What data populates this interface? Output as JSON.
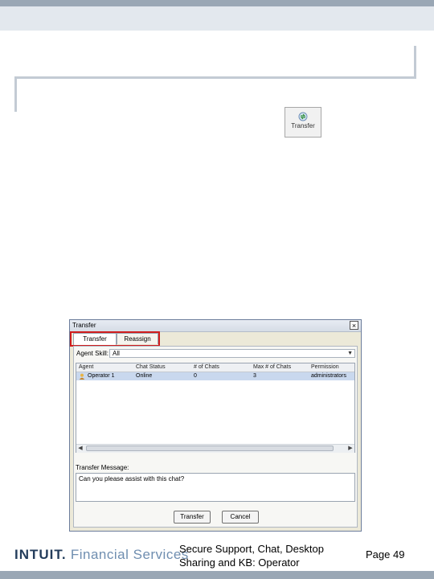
{
  "toolbar": {
    "transfer_label": "Transfer"
  },
  "dialog": {
    "title": "Transfer",
    "close_glyph": "×",
    "tabs": [
      {
        "label": "Transfer",
        "active": true
      },
      {
        "label": "Reassign",
        "active": false
      }
    ],
    "agent_skill_label": "Agent Skill:",
    "agent_skill_value": "All",
    "columns": [
      "Agent",
      "Chat Status",
      "# of Chats",
      "Max # of Chats",
      "Permission"
    ],
    "rows": [
      {
        "agent": "Operator 1",
        "status": "Online",
        "chats": "0",
        "max_chats": "3",
        "permission": "administrators"
      }
    ],
    "transfer_message_label": "Transfer Message:",
    "transfer_message_value": "Can you please assist with this chat?",
    "buttons": {
      "transfer": "Transfer",
      "cancel": "Cancel"
    }
  },
  "footer": {
    "logo_brand": "INTUIT.",
    "logo_sub": "Financial Services",
    "title": "Secure Support, Chat, Desktop Sharing and KB: Operator",
    "page": "Page 49"
  },
  "colors": {
    "highlight": "#d11d1d",
    "selected_row": "#c9d8ee",
    "header_bar": "#9aa7b5"
  }
}
